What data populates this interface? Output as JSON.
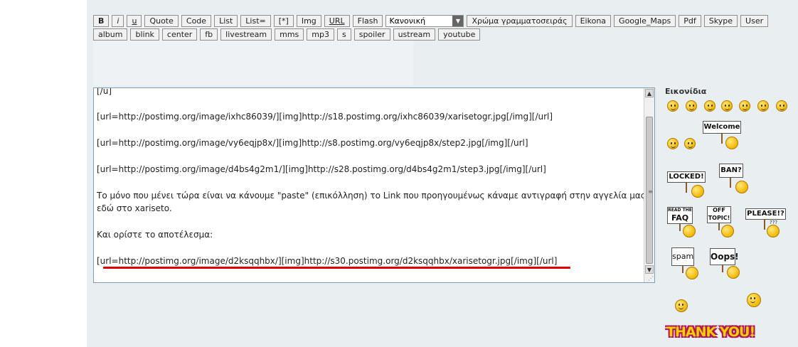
{
  "toolbar": {
    "row1": [
      {
        "label": "B",
        "style": "b"
      },
      {
        "label": "i",
        "style": "i"
      },
      {
        "label": "u",
        "style": "u"
      },
      {
        "label": "Quote"
      },
      {
        "label": "Code"
      },
      {
        "label": "List"
      },
      {
        "label": "List="
      },
      {
        "label": "[*]"
      },
      {
        "label": "Img"
      },
      {
        "label": "URL",
        "style": "u"
      },
      {
        "label": "Flash"
      }
    ],
    "font_size_select": "Κανονική",
    "row1_after": [
      {
        "label": "Χρώμα γραμματοσειράς"
      },
      {
        "label": "Eikona"
      },
      {
        "label": "Google_Maps"
      },
      {
        "label": "Pdf"
      },
      {
        "label": "Skype"
      },
      {
        "label": "User"
      }
    ],
    "row2": [
      {
        "label": "album"
      },
      {
        "label": "blink"
      },
      {
        "label": "center"
      },
      {
        "label": "fb"
      },
      {
        "label": "livestream"
      },
      {
        "label": "mms"
      },
      {
        "label": "mp3"
      },
      {
        "label": "s"
      },
      {
        "label": "spoiler"
      },
      {
        "label": "ustream"
      },
      {
        "label": "youtube"
      }
    ]
  },
  "editor": {
    "lines": [
      "[/u]",
      "[url=http://postimg.org/image/ixhc86039/][img]http://s18.postimg.org/ixhc86039/xarisetogr.jpg[/img][/url]",
      "[url=http://postimg.org/image/vy6eqjp8x/][img]http://s8.postimg.org/vy6eqjp8x/step2.jpg[/img][/url]",
      "[url=http://postimg.org/image/d4bs4g2m1/][img]http://s28.postimg.org/d4bs4g2m1/step3.jpg[/img][/url]",
      "Το μόνο που μένει τώρα είναι να κάνουμε \"paste\" (επικόλληση) το Link που προηγουμένως κάναμε αντιγραφή στην αγγελία μας",
      "εδώ στο xariseto.",
      "Και ορίστε το αποτέλεσμα:",
      "[url=http://postimg.org/image/d2ksqqhbx/][img]http://s30.postimg.org/d2ksqqhbx/xarisetogr.jpg[/img][/url]"
    ]
  },
  "smilies": {
    "title": "Εικονίδια",
    "signs": {
      "welcome": "Welcome",
      "locked": "LOCKED!",
      "ban": "BAN?",
      "faq_top": "READ THE",
      "faq_bottom": "FAQ",
      "offtopic_top": "OFF",
      "offtopic_bottom": "TOPIC!",
      "please": "PLEASE!?",
      "please_sub": "???",
      "spam": "spam",
      "oops": "Oops!",
      "thanks": "THANK YOU!"
    }
  },
  "colors": {
    "panel_bg": "#e9eef1",
    "editor_border": "#7f9db9",
    "highlight_red": "#e30000"
  }
}
